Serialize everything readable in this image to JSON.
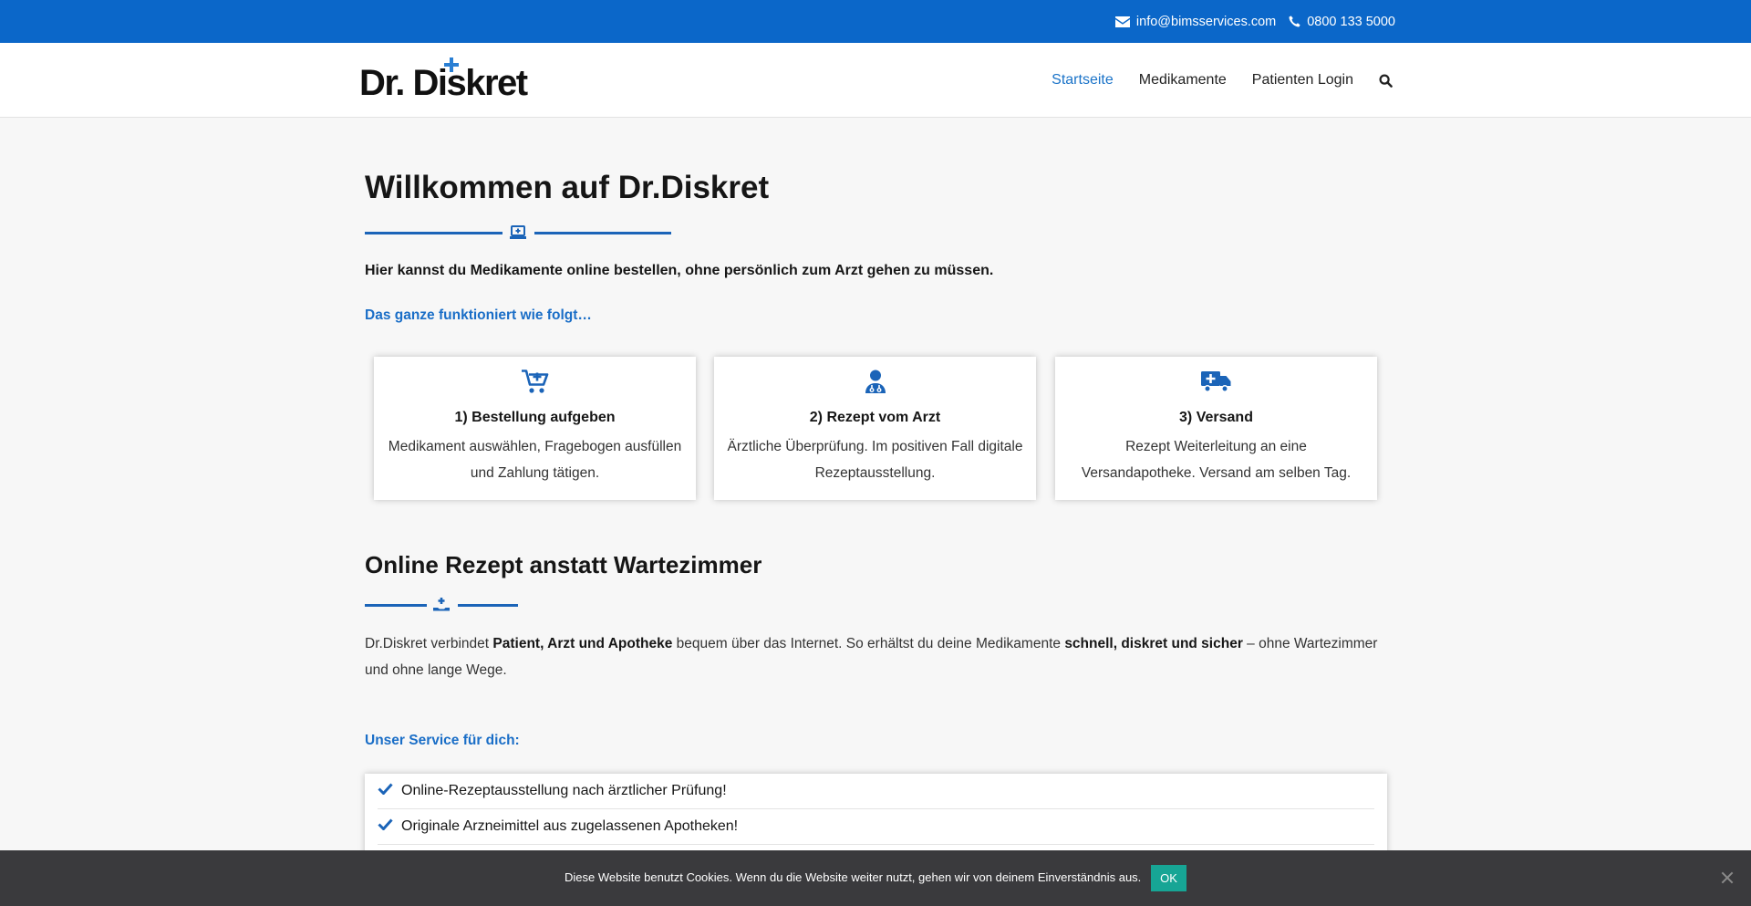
{
  "topbar": {
    "email": "info@bimsservices.com",
    "email_icon": "envelope-icon",
    "phone": "0800 133 5000",
    "phone_icon": "phone-icon"
  },
  "header": {
    "logo_text": "Dr. Diskret",
    "nav": [
      {
        "label": "Startseite",
        "active": true
      },
      {
        "label": "Medikamente",
        "active": false
      },
      {
        "label": "Patienten Login",
        "active": false
      }
    ],
    "search_icon": "search-icon"
  },
  "main": {
    "title": "Willkommen auf Dr.Diskret",
    "title_icon": "laptop-medical-icon",
    "lead": "Hier kannst du Medikamente online bestellen, ohne persönlich zum Arzt gehen zu müssen.",
    "how_it_works": "Das ganze funktioniert wie folgt…",
    "steps": [
      {
        "icon": "cart-plus-icon",
        "title": "1) Bestellung aufgeben",
        "text": "Medikament auswählen, Fragebogen ausfüllen und Zahlung tätigen."
      },
      {
        "icon": "doctor-icon",
        "title": "2) Rezept vom Arzt",
        "text": "Ärztliche Überprüfung. Im positiven Fall digitale Rezeptausstellung."
      },
      {
        "icon": "truck-medical-icon",
        "title": "3) Versand",
        "text": "Rezept Weiterleitung an eine Versandapotheke. Versand am selben Tag."
      }
    ],
    "section2_title": "Online Rezept anstatt Wartezimmer",
    "section2_icon": "hand-holding-medical-icon",
    "para": {
      "t1": "Dr.Diskret verbindet ",
      "b1": "Patient, Arzt und Apotheke",
      "t2": " bequem über das Internet. So erhältst du deine Medikamente ",
      "b2": "schnell, diskret und sicher",
      "t3": " – ohne Wartezimmer und ohne lange Wege."
    },
    "service_heading": "Unser Service für dich:",
    "service_items": [
      "Online-Rezeptausstellung nach ärztlicher Prüfung!",
      "Originale Arzneimittel aus zugelassenen Apotheken!"
    ]
  },
  "cookie": {
    "message": "Diese Website benutzt Cookies. Wenn du die Website weiter nutzt, gehen wir von deinem Einverständnis aus.",
    "ok_label": "OK"
  },
  "colors": {
    "brand_blue": "#0b67c9",
    "link_blue": "#1a6ec7",
    "cookie_bg": "#3a3a3d",
    "ok_green": "#17a595"
  }
}
